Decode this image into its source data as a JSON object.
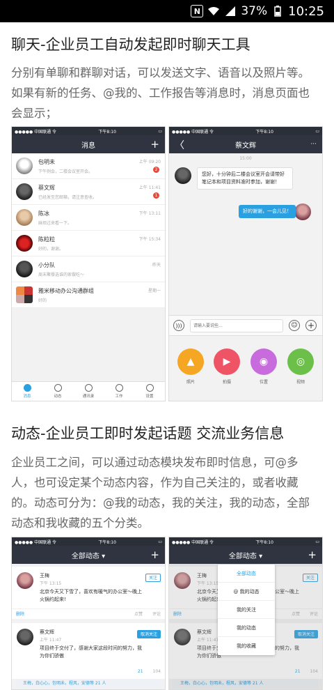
{
  "status_bar": {
    "nfc": "N",
    "battery": "37%",
    "time": "10:25"
  },
  "section1": {
    "title": "聊天-企业员工自动发起即时聊天工具",
    "lines": [
      "分别有单聊和群聊对话，可以发送文字、语音以及照片等。",
      "如果有新的任务、@我的、工作报告等消息时，消息页面也",
      "会显示；"
    ]
  },
  "shot_messages": {
    "carrier": "●●●●● 中国联通 令",
    "time": "下午8:10",
    "battery": "▭",
    "title": "消息",
    "plus": "+",
    "items": [
      {
        "name": "包明未",
        "msg": "下午例会，二楼会议室开会。",
        "time": "上午 09:20",
        "badge": "2"
      },
      {
        "name": "蔡文辉",
        "msg": "已经发至您邮箱，请注意查收。",
        "time": "上午 11:41",
        "badge": "1"
      },
      {
        "name": "陈冰",
        "msg": "麻烦过来看一下。",
        "time": "下午 13:11",
        "badge": ""
      },
      {
        "name": "陈粒粒",
        "msg": "好的，谢谢。",
        "time": "下午 15:34",
        "badge": ""
      },
      {
        "name": "小分队",
        "msg": "周末聚餐选谁的家做吃～",
        "time": "昨天",
        "badge": ""
      },
      {
        "name": "雅米移动办公沟通群组",
        "msg": "好的",
        "time": "星期一",
        "badge": ""
      }
    ],
    "tabs": [
      "消息",
      "动态",
      "通讯录",
      "工作",
      "设置"
    ]
  },
  "shot_chat": {
    "carrier": "●●●●● 中国联通 令",
    "time": "下午8:10",
    "battery": "▭",
    "back": "〈",
    "title": "蔡文辉",
    "more": "···",
    "stamp": "15:00",
    "incoming": "您好，十分钟后二楼会议室开会请带好笔记本和项目资料准时参加，谢谢！",
    "outgoing": "好的谢谢，一会儿见！",
    "input_placeholder": "请输入要说些...",
    "actions": [
      "照片",
      "拍摄",
      "位置",
      "视频"
    ],
    "action_colors": [
      "#f5a623",
      "#ef5466",
      "#c86bdd",
      "#6cc04a"
    ]
  },
  "section2": {
    "title": "动态-企业员工即时发起话题 交流业务信息",
    "lines": [
      "企业员工之间，可以通过动态模块发布即时信息，可@多",
      "人，也可设定某个动态内容，作为自己关注的，或者收藏",
      "的。动态可分为：@我的动态，我的关注，我的动态，全部",
      "动态和我收藏的五个分类。"
    ]
  },
  "shot_feed_left": {
    "carrier": "●●●●● 中国联通 令",
    "time": "下午8:10",
    "battery": "▭",
    "title": "全部动态 ▾",
    "plus": "+",
    "posts": [
      {
        "name": "王梅",
        "time": "下午 13:15",
        "follow": "关注",
        "body": "北京今天又下雪了，喜欢有暖气的办公室～晚上火锅约起来!",
        "delete": "删除",
        "like": "点赞",
        "comment": "评论"
      },
      {
        "name": "蔡文辉",
        "time": "上午 11:47",
        "follow": "取消关注",
        "body": "项目终于交付了，感谢大家这段时间的努力，我为你们骄傲",
        "likes": "21",
        "comments": "104"
      }
    ],
    "likers": "王梅，白心心，包明未，程风，安德等 21 人"
  },
  "shot_feed_right": {
    "carrier": "●●●●● 中国联通 令",
    "time": "下午8:10",
    "battery": "▭",
    "title": "全部动态 ▾",
    "plus": "+",
    "menu": [
      "全部动态",
      "@ 我的动态",
      "我的关注",
      "我的动态",
      "我的收藏"
    ],
    "posts": [
      {
        "name": "王梅",
        "time": "下午 13:15",
        "follow": "关注",
        "body": "北京今天又下雪了，喜欢有暖气的办公室～晚上火锅约起来!",
        "delete": "删除",
        "like": "点赞",
        "comment": "评论"
      },
      {
        "name": "蔡文辉",
        "time": "上午 11:47",
        "follow": "取消关注",
        "body": "项目终于交付了，感谢大家这段时间的努力，我为你们骄傲",
        "likes": "21",
        "comments": "104"
      }
    ],
    "likers": "王梅，白心心，包明未，程风，安德等 21 人"
  }
}
